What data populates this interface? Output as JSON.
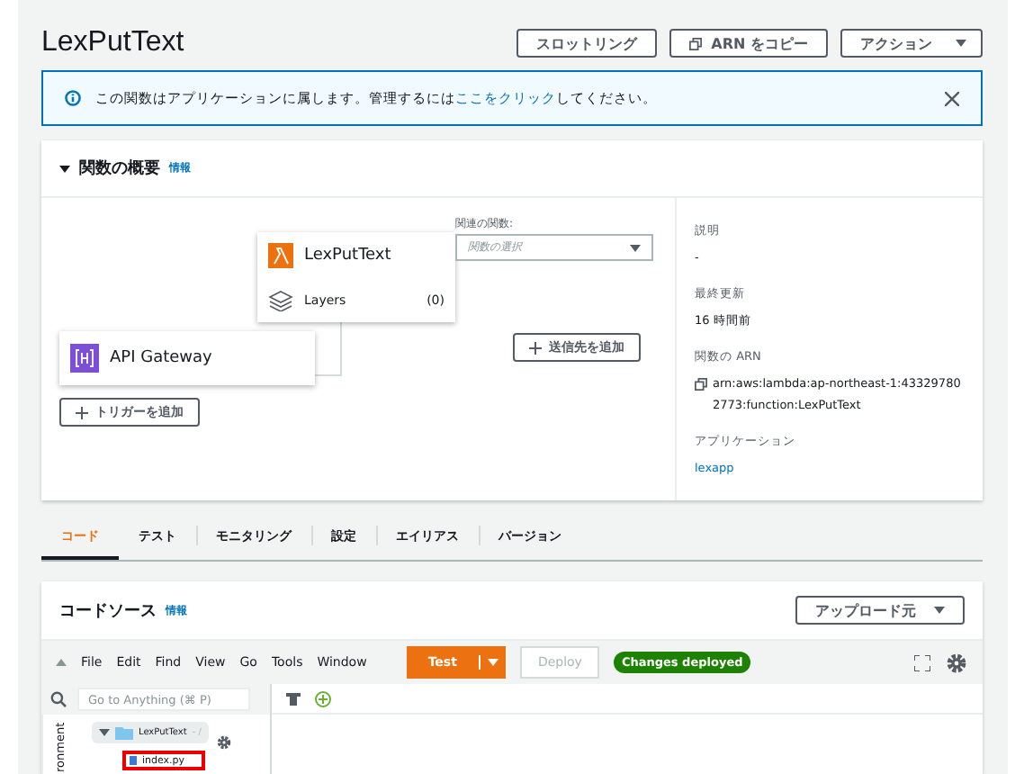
{
  "header": {
    "title": "LexPutText",
    "buttons": [
      {
        "label": "スロットリング",
        "kind": "plain"
      },
      {
        "label": "ARN をコピー",
        "kind": "copy"
      },
      {
        "label": "アクション",
        "kind": "menu"
      }
    ]
  },
  "banner": {
    "before": "この関数はアプリケーションに属します。管理するには",
    "link": "ここをクリック",
    "after": "してください。"
  },
  "overview": {
    "title": "関数の概要",
    "info": "情報",
    "expanded": true,
    "function_node": {
      "name": "LexPutText",
      "layers_label": "Layers",
      "layers_count": "(0)"
    },
    "related": {
      "label": "関連の関数:",
      "placeholder": "関数の選択"
    },
    "trigger_node": {
      "name": "API Gateway"
    },
    "add_trigger": "トリガーを追加",
    "add_destination": "送信先を追加",
    "details": [
      {
        "label": "説明",
        "value": "-",
        "kind": "text"
      },
      {
        "label": "最終更新",
        "value": "16 時間前",
        "kind": "text"
      },
      {
        "label": "関数の ARN",
        "value": "arn:aws:lambda:ap-northeast-1:433297802773:function:LexPutText",
        "kind": "arn"
      },
      {
        "label": "アプリケーション",
        "value": "lexapp",
        "kind": "link"
      }
    ]
  },
  "tabs": [
    {
      "label": "コード",
      "selected": true
    },
    {
      "label": "テスト",
      "selected": false
    },
    {
      "label": "モニタリング",
      "selected": false
    },
    {
      "label": "設定",
      "selected": false
    },
    {
      "label": "エイリアス",
      "selected": false
    },
    {
      "label": "バージョン",
      "selected": false
    }
  ],
  "code_source": {
    "title": "コードソース",
    "info": "情報",
    "upload_button": "アップロード元",
    "menu": [
      "File",
      "Edit",
      "Find",
      "View",
      "Go",
      "Tools",
      "Window"
    ],
    "test_button": "Test",
    "deploy_button": "Deploy",
    "deploy_disabled": true,
    "status_badge": "Changes deployed",
    "search_placeholder": "Go to Anything (⌘ P)",
    "side_tab": "ronment",
    "tree": [
      {
        "name": "LexPutText",
        "suffix": "- /",
        "expanded": true,
        "children": [
          {
            "name": "index.py",
            "highlighted": true
          }
        ]
      }
    ]
  }
}
